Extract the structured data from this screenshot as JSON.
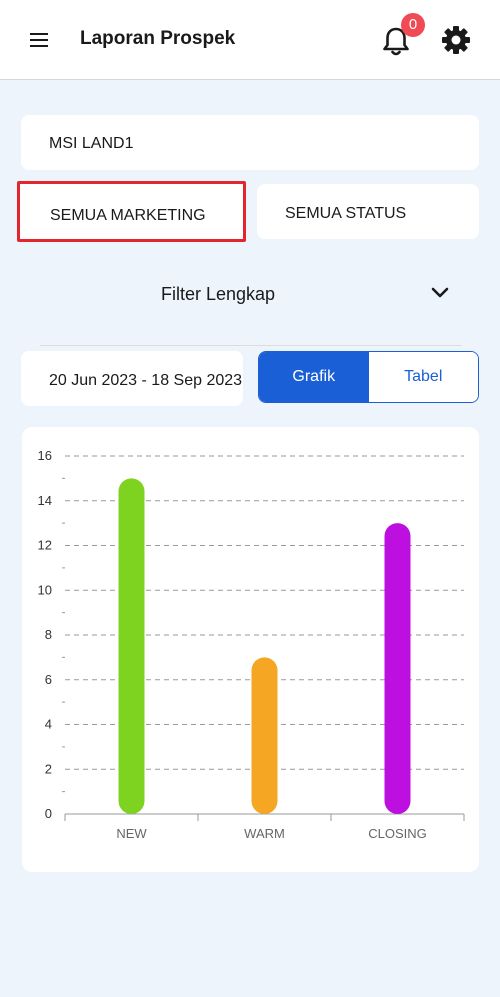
{
  "header": {
    "title": "Laporan Prospek",
    "notification_count": "0"
  },
  "filters": {
    "project": "MSI LAND1",
    "marketing": "SEMUA MARKETING",
    "status": "SEMUA STATUS",
    "filter_toggle_label": "Filter Lengkap",
    "date_range": "20 Jun 2023 - 18 Sep 2023"
  },
  "view_tabs": {
    "grafik": "Grafik",
    "tabel": "Tabel",
    "active": "Grafik"
  },
  "colors": {
    "primary": "#1a5fd6",
    "badge": "#f04b55",
    "highlight_border": "#e3262d"
  },
  "chart_data": {
    "type": "bar",
    "categories": [
      "NEW",
      "WARM",
      "CLOSING"
    ],
    "values": [
      15,
      7,
      13
    ],
    "colors": [
      "#7ed321",
      "#f5a623",
      "#bd10e0"
    ],
    "ylim": [
      0,
      16
    ],
    "y_ticks": [
      0,
      2,
      4,
      6,
      8,
      10,
      12,
      14,
      16
    ],
    "grid": true
  }
}
